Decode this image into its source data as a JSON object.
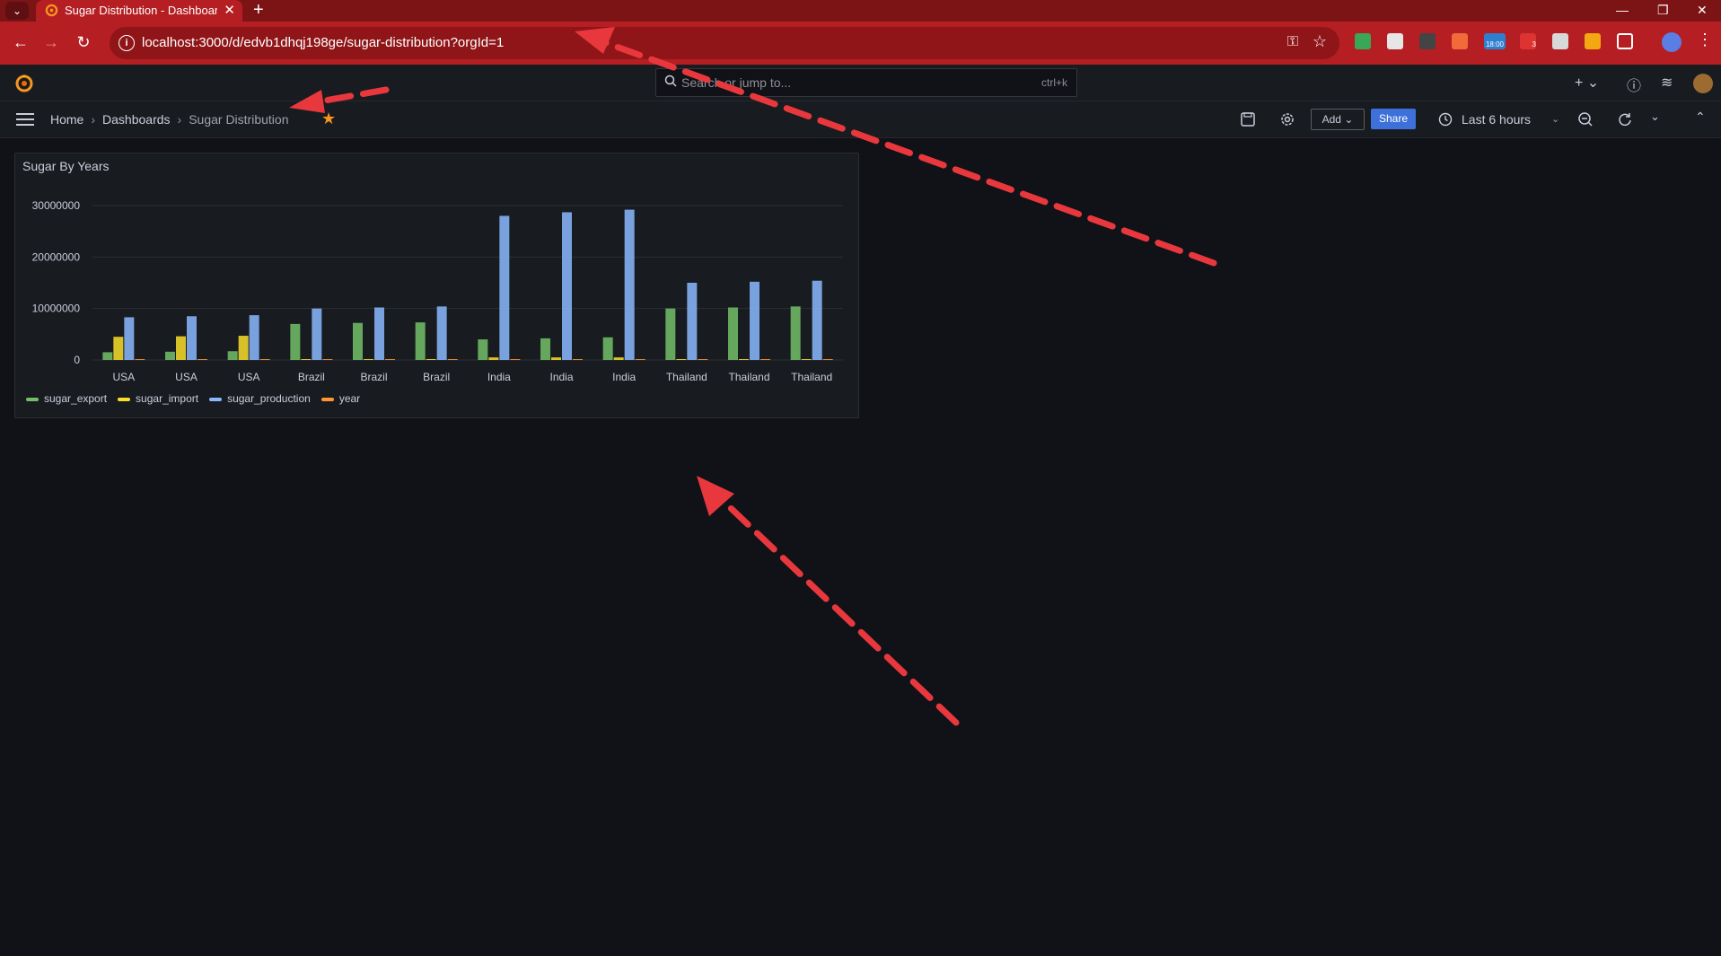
{
  "browser": {
    "tab_title": "Sugar Distribution - Dashboards - Grafana",
    "url": "localhost:3000/d/edvb1dhqj198ge/sugar-distribution?orgId=1",
    "ext_badge_time": "18:00",
    "ext_badge_count": "3",
    "theme_color": "#b51e22"
  },
  "grafana": {
    "search_placeholder": "Search or jump to...",
    "search_shortcut": "ctrl+k",
    "breadcrumbs": [
      "Home",
      "Dashboards",
      "Sugar Distribution"
    ],
    "add_label": "Add",
    "share_label": "Share",
    "time_range": "Last 6 hours"
  },
  "panel": {
    "title": "Sugar By Years"
  },
  "chart_data": {
    "type": "bar",
    "title": "Sugar By Years",
    "categories": [
      "USA",
      "USA",
      "USA",
      "Brazil",
      "Brazil",
      "Brazil",
      "India",
      "India",
      "India",
      "Thailand",
      "Thailand",
      "Thailand"
    ],
    "ylim": [
      0,
      30000000
    ],
    "yticks": [
      "30000000",
      "20000000",
      "10000000",
      "0"
    ],
    "grid": true,
    "legend_position": "bottom-left",
    "series": [
      {
        "name": "sugar_export",
        "color": "#73bf69",
        "values": [
          1500000,
          1600000,
          1700000,
          7000000,
          7200000,
          7300000,
          4000000,
          4200000,
          4400000,
          10000000,
          10200000,
          10400000
        ]
      },
      {
        "name": "sugar_import",
        "color": "#fade2a",
        "values": [
          4500000,
          4600000,
          4700000,
          100000,
          100000,
          100000,
          500000,
          500000,
          500000,
          100000,
          100000,
          100000
        ]
      },
      {
        "name": "sugar_production",
        "color": "#8ab8ff",
        "values": [
          8300000,
          8500000,
          8700000,
          10000000,
          10200000,
          10400000,
          28000000,
          28700000,
          29200000,
          15000000,
          15200000,
          15400000
        ]
      },
      {
        "name": "year",
        "color": "#ff9830",
        "values": [
          2020,
          2021,
          2022,
          2020,
          2021,
          2022,
          2020,
          2021,
          2022,
          2020,
          2021,
          2022
        ]
      }
    ]
  }
}
